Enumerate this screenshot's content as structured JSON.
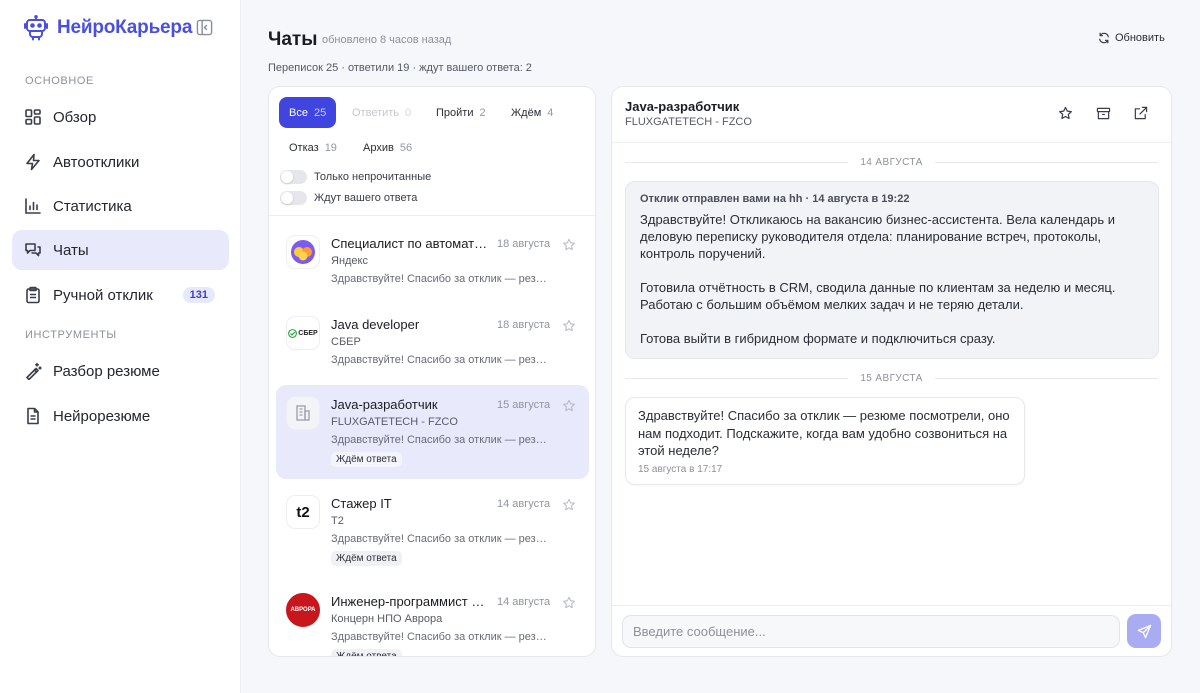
{
  "app": {
    "name": "НейроКарьера"
  },
  "sidebar": {
    "section_main": "Основное",
    "section_tools": "Инструменты",
    "items": [
      {
        "label": "Обзор",
        "icon": "grid-icon"
      },
      {
        "label": "Автоотклики",
        "icon": "lightning-icon"
      },
      {
        "label": "Статистика",
        "icon": "bar-chart-icon"
      },
      {
        "label": "Чаты",
        "icon": "chat-bubbles-icon",
        "active": true
      },
      {
        "label": "Ручной отклик",
        "icon": "clipboard-icon",
        "badge": "131"
      }
    ],
    "tools": [
      {
        "label": "Разбор резюме",
        "icon": "wand-icon"
      },
      {
        "label": "Нейрорезюме",
        "icon": "document-icon"
      }
    ]
  },
  "header": {
    "title": "Чаты",
    "updated": "обновлено 8 часов назад",
    "summary": "Переписок 25 · ответили 19 · ждут вашего ответа: 2",
    "refresh_label": "Обновить"
  },
  "filters": {
    "tabs": [
      {
        "label": "Все",
        "count": "25",
        "state": "active"
      },
      {
        "label": "Ответить",
        "count": "0",
        "state": "disabled"
      },
      {
        "label": "Пройти",
        "count": "2",
        "state": "normal"
      },
      {
        "label": "Ждём",
        "count": "4",
        "state": "normal"
      },
      {
        "label": "Отказ",
        "count": "19",
        "state": "normal"
      },
      {
        "label": "Архив",
        "count": "56",
        "state": "normal"
      }
    ],
    "toggle_unread": "Только непрочитанные",
    "toggle_waiting": "Ждут вашего ответа"
  },
  "chats": [
    {
      "title": "Специалист по автоматизации",
      "company": "Яндекс",
      "date": "18 августа",
      "preview": "Здравствуйте! Спасибо за отклик — резюме посмотрели",
      "badge": "",
      "avatar": "yandex-logo"
    },
    {
      "title": "Java developer",
      "company": "СБЕР",
      "date": "18 августа",
      "preview": "Здравствуйте! Спасибо за отклик — резюме посмотрели",
      "badge": "",
      "avatar": "sber-logo",
      "avatar_text": "СБЕР"
    },
    {
      "title": "Java-разработчик",
      "company": "FLUXGATETECH - FZCO",
      "date": "15 августа",
      "preview": "Здравствуйте! Спасибо за отклик — резюме посмотрели",
      "badge": "Ждём ответа",
      "avatar": "building-icon",
      "selected": true
    },
    {
      "title": "Стажер IT",
      "company": "Т2",
      "date": "14 августа",
      "preview": "Здравствуйте! Спасибо за отклик — резюме посмотрели",
      "badge": "Ждём ответа",
      "avatar": "t2-logo",
      "avatar_text": "t2"
    },
    {
      "title": "Инженер-программист по разработке ПО",
      "company": "Концерн НПО Аврора",
      "date": "14 августа",
      "preview": "Здравствуйте! Спасибо за отклик — резюме посмотрели",
      "badge": "Ждём ответа",
      "avatar": "avrora-logo",
      "avatar_text": "АВРОРА"
    }
  ],
  "conversation": {
    "title": "Java-разработчик",
    "company": "FLUXGATETECH - FZCO",
    "day1": "14 августа",
    "out_meta": "Отклик отправлен вами на hh · 14 августа в 19:22",
    "out_paragraphs": [
      "Здравствуйте! Откликаюсь на вакансию бизнес-ассистента. Вела календарь и деловую переписку руководителя отдела: планирование встреч, протоколы, контроль поручений.",
      "Готовила отчётность в CRM, сводила данные по клиентам за неделю и месяц. Работаю с большим объёмом мелких задач и не теряю детали.",
      "Готова выйти в гибридном формате и подключиться сразу."
    ],
    "day2": "15 августа",
    "in_text": "Здравствуйте! Спасибо за отклик — резюме посмотрели, оно нам подходит. Подскажите, когда вам удобно созвониться на этой неделе?",
    "in_time": "15 августа в 17:17",
    "input_placeholder": "Введите сообщение..."
  },
  "colors": {
    "accent": "#4145e0",
    "accent_soft": "#e8e9fb",
    "send_button": "#a9acf2",
    "badge_bg": "#e6e8fb"
  }
}
